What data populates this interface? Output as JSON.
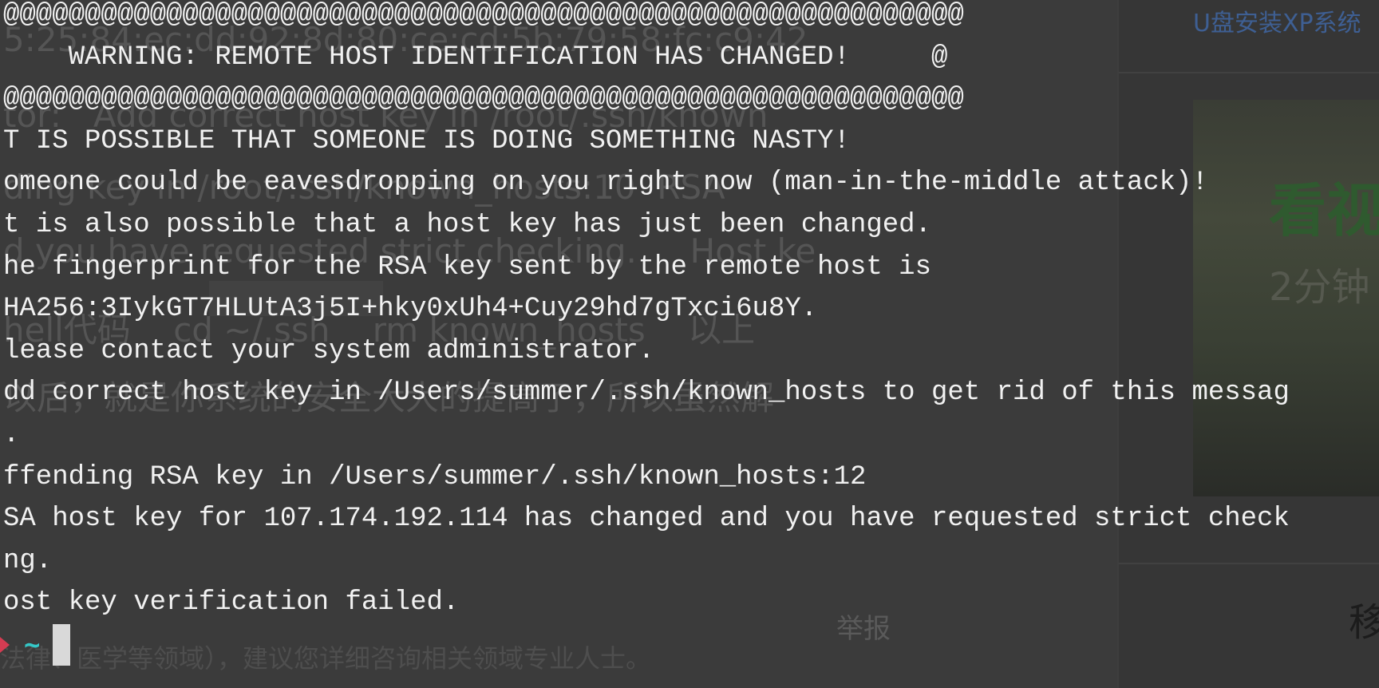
{
  "background_page": {
    "sidebar_title": "U盘安装XP系统",
    "faint_lines": [
      "5:25:84:ec:dd:92:8d:80:ce:cd:5b:79:58:fc:c9:42.",
      "tor:   Add correct host key in /root/.ssh/known",
      "ding key in /root/.ssh/known_hosts:10  RSA",
      "d you have requested strict checking.     Host ke",
      "hell代码    cd ~/.ssh    rm known_hosts    以上",
      "以后，就是你系统的安全大大的提高了，所以虽然解"
    ],
    "image_text_1": "看视",
    "image_text_2": "2分钟",
    "report_label": "举报",
    "right_char": "移",
    "footer_text": "法律、医学等领域），建议您详细咨询相关领域专业人士。"
  },
  "terminal": {
    "lines": [
      "@@@@@@@@@@@@@@@@@@@@@@@@@@@@@@@@@@@@@@@@@@@@@@@@@@@@@@@@@@@",
      "    WARNING: REMOTE HOST IDENTIFICATION HAS CHANGED!     @",
      "@@@@@@@@@@@@@@@@@@@@@@@@@@@@@@@@@@@@@@@@@@@@@@@@@@@@@@@@@@@",
      "T IS POSSIBLE THAT SOMEONE IS DOING SOMETHING NASTY!",
      "omeone could be eavesdropping on you right now (man-in-the-middle attack)!",
      "t is also possible that a host key has just been changed.",
      "he fingerprint for the RSA key sent by the remote host is",
      "HA256:3IykGT7HLUtA3j5I+hky0xUh4+Cuy29hd7gTxci6u8Y.",
      "lease contact your system administrator.",
      "dd correct host key in /Users/summer/.ssh/known_hosts to get rid of this messag",
      ".",
      "ffending RSA key in /Users/summer/.ssh/known_hosts:12",
      "SA host key for 107.174.192.114 has changed and you have requested strict check",
      "ng.",
      "ost key verification failed."
    ],
    "prompt_symbol": "~"
  },
  "colors": {
    "terminal_bg": "#3b3b3b",
    "text": "#f1f1f1",
    "prompt_tilde": "#35c7c7",
    "prompt_arrow": "#d43c52",
    "link": "#3e5f93"
  }
}
